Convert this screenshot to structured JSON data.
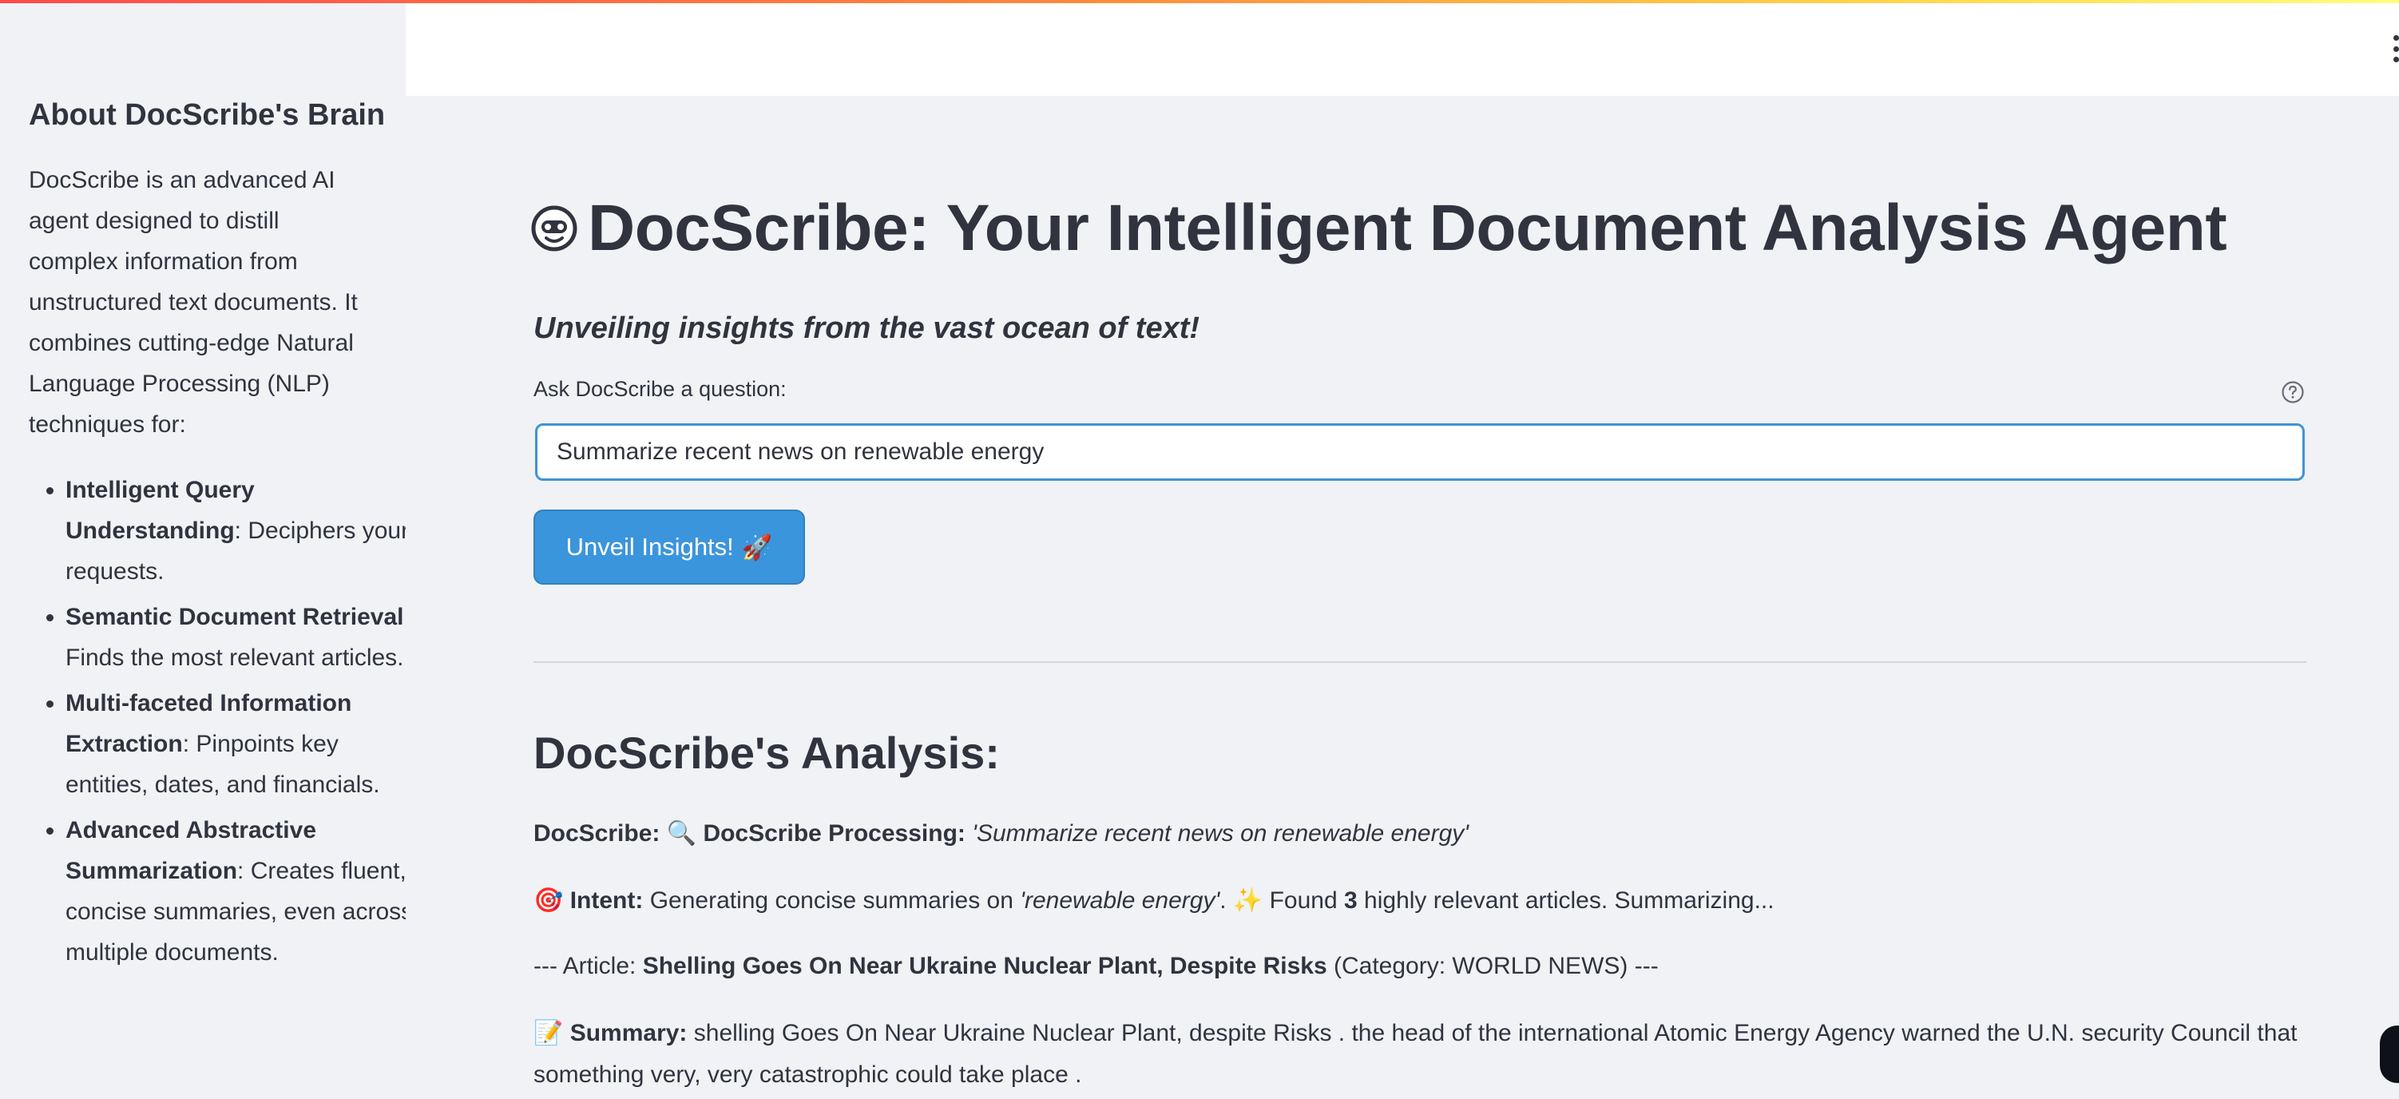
{
  "sidebar": {
    "title": "About DocScribe's Brain",
    "intro": "DocScribe is an advanced AI agent designed to distill complex information from unstructured text documents. It combines cutting-edge Natural Language Processing (NLP) techniques for:",
    "items": [
      {
        "bold": "Intelligent Query Understanding",
        "rest": ": Deciphers your requests."
      },
      {
        "bold": "Semantic Document Retrieval",
        "rest": ": Finds the most relevant articles."
      },
      {
        "bold": "Multi-faceted Information Extraction",
        "rest": ": Pinpoints key entities, dates, and financials."
      },
      {
        "bold": "Advanced Abstractive Summarization",
        "rest": ": Creates fluent, concise summaries, even across multiple documents."
      }
    ]
  },
  "main": {
    "title": "DocScribe: Your Intelligent Document Analysis Agent",
    "subtitle": "Unveiling insights from the vast ocean of text!",
    "question_label": "Ask DocScribe a question:",
    "query_value": "Summarize recent news on renewable energy",
    "button_label": "Unveil Insights!",
    "button_emoji": "🚀",
    "analysis_heading": "DocScribe's Analysis:",
    "line1": {
      "prefix": "DocScribe:",
      "emoji": "🔍",
      "label": "DocScribe Processing:",
      "query": "'Summarize recent news on renewable energy'"
    },
    "line2": {
      "emoji": "🎯",
      "label": "Intent:",
      "text_a": "Generating concise summaries on",
      "topic": "'renewable energy'",
      "sparkle": "✨",
      "text_b": "Found",
      "count": "3",
      "text_c": "highly relevant articles. Summarizing..."
    },
    "line3": {
      "prefix": "--- Article:",
      "article_title": "Shelling Goes On Near Ukraine Nuclear Plant, Despite Risks",
      "category": "(Category: WORLD NEWS) ---"
    },
    "line4": {
      "emoji": "📝",
      "label": "Summary:",
      "text": "shelling Goes On Near Ukraine Nuclear Plant, despite Risks . the head of the international Atomic Energy Agency warned the U.N. security Council that something very, very catastrophic could take place ."
    }
  },
  "icons": {
    "title_icon": "robot-face-icon",
    "help": "question-circle-icon",
    "menu": "kebab-menu-icon"
  },
  "colors": {
    "accent": "#3b95dc",
    "input_border": "#3f93d6",
    "background": "#f0f2f6"
  }
}
